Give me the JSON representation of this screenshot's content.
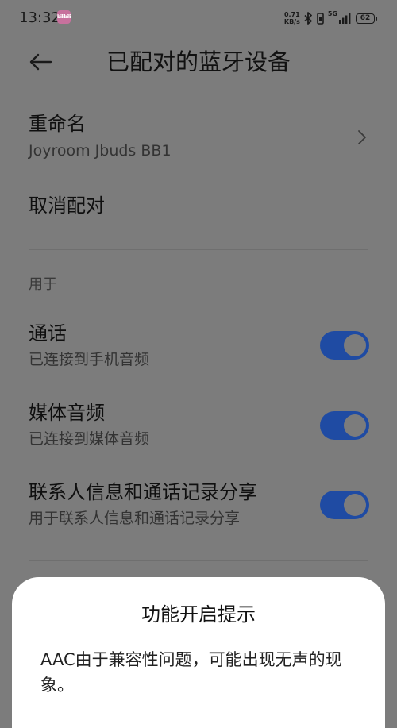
{
  "status_bar": {
    "time": "13:32",
    "app_icon_text": "bilibili",
    "net_speed_value": "0.71",
    "net_speed_unit": "KB/s",
    "network_gen": "5G",
    "battery": "62"
  },
  "header": {
    "title": "已配对的蓝牙设备"
  },
  "rename": {
    "title": "重命名",
    "device_name": "Joyroom Jbuds BB1"
  },
  "unpair": {
    "title": "取消配对"
  },
  "usage_section": {
    "label": "用于",
    "items": [
      {
        "title": "通话",
        "subtitle": "已连接到手机音频",
        "enabled": true
      },
      {
        "title": "媒体音频",
        "subtitle": "已连接到媒体音频",
        "enabled": true
      },
      {
        "title": "联系人信息和通话记录分享",
        "subtitle": "用于联系人信息和通话记录分享",
        "enabled": true
      }
    ]
  },
  "dialog": {
    "title": "功能开启提示",
    "body": "AAC由于兼容性问题，可能出现无声的现象。"
  },
  "colors": {
    "scrim_background": "#7c7c7c",
    "toggle_on": "#1f4ba3",
    "dialog_background": "#ffffff"
  }
}
